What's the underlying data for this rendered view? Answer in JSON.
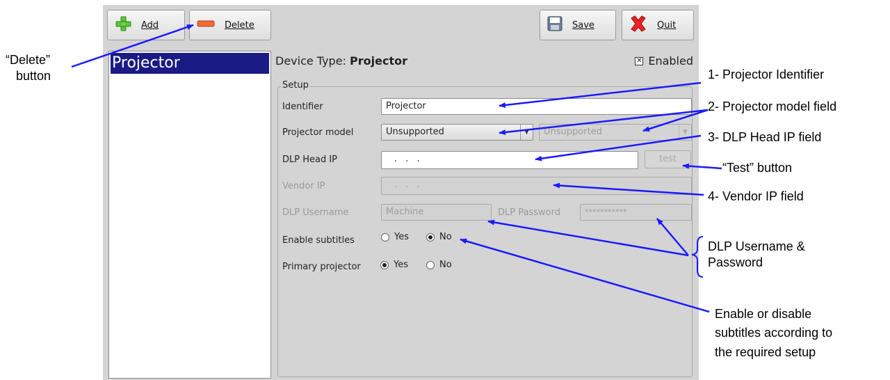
{
  "toolbar": {
    "add_label": "Add",
    "delete_label": "Delete",
    "save_label": "Save",
    "quit_label": "Quit"
  },
  "device_list": {
    "items": [
      "Projector"
    ]
  },
  "header": {
    "device_type_label": "Device Type:",
    "device_type_value": "Projector",
    "enabled_label": "Enabled",
    "enabled_checked": true
  },
  "setup": {
    "group_title": "Setup",
    "identifier": {
      "label": "Identifier",
      "value": "Projector"
    },
    "projector_model": {
      "label": "Projector model",
      "value": "Unsupported",
      "secondary_value": "Unsupported"
    },
    "dlp_head_ip": {
      "label": "DLP Head IP",
      "value": ". . .",
      "test_label": "test"
    },
    "vendor_ip": {
      "label": "Vendor IP",
      "value": ". . ."
    },
    "dlp_username": {
      "label": "DLP Username",
      "value": "Machine"
    },
    "dlp_password": {
      "label": "DLP Password",
      "value": "***********"
    },
    "enable_subtitles": {
      "label": "Enable subtitles",
      "yes": "Yes",
      "no": "No",
      "selected": "No"
    },
    "primary_projector": {
      "label": "Primary projector",
      "yes": "Yes",
      "no": "No",
      "selected": "Yes"
    }
  },
  "annotations": {
    "delete_line1": "“Delete”",
    "delete_line2": "button",
    "identifier": "1- Projector Identifier",
    "model": "2- Projector model field",
    "dlp_head": "3- DLP Head IP field",
    "test": "“Test” button",
    "vendor": "4- Vendor IP field",
    "userpass_line1": "DLP Username &",
    "userpass_line2": "Password",
    "subtitles_line1": "Enable or disable",
    "subtitles_line2": "subtitles according to",
    "subtitles_line3": "the required setup"
  },
  "colors": {
    "selection": "#1b1b85",
    "arrow": "#1a1aff",
    "window_bg": "#d4d4d4"
  }
}
